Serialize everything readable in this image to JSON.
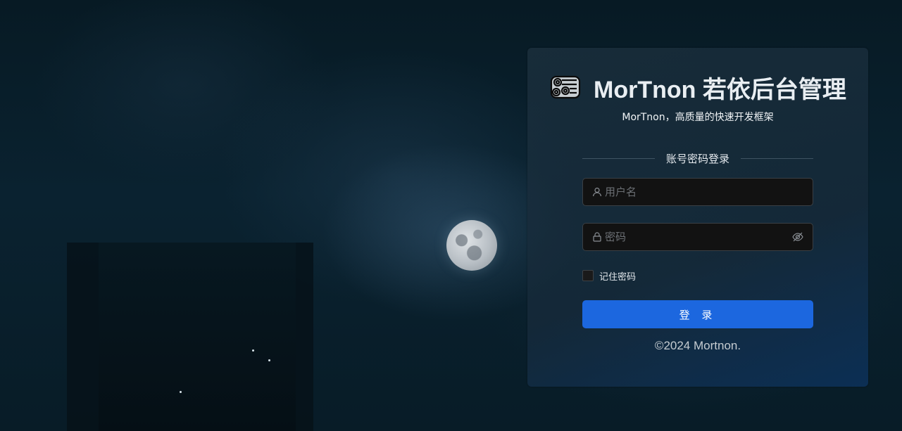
{
  "brand": {
    "logo_icon": "log-stack-icon",
    "title": "MorTnon 若依后台管理",
    "subtitle": "MorTnon，高质量的快速开发框架"
  },
  "login": {
    "section_label": "账号密码登录",
    "username": {
      "icon": "user-icon",
      "value": "",
      "placeholder": "用户名"
    },
    "password": {
      "icon": "lock-icon",
      "value": "",
      "placeholder": "密码",
      "toggle_icon": "eye-off-icon"
    },
    "remember": {
      "label": "记住密码",
      "checked": false
    },
    "submit_label": "登 录"
  },
  "footer": {
    "copyright": "©2024 Mortnon."
  },
  "colors": {
    "primary": "#1c67df",
    "background": "#0a2230",
    "input_bg": "#121212"
  }
}
